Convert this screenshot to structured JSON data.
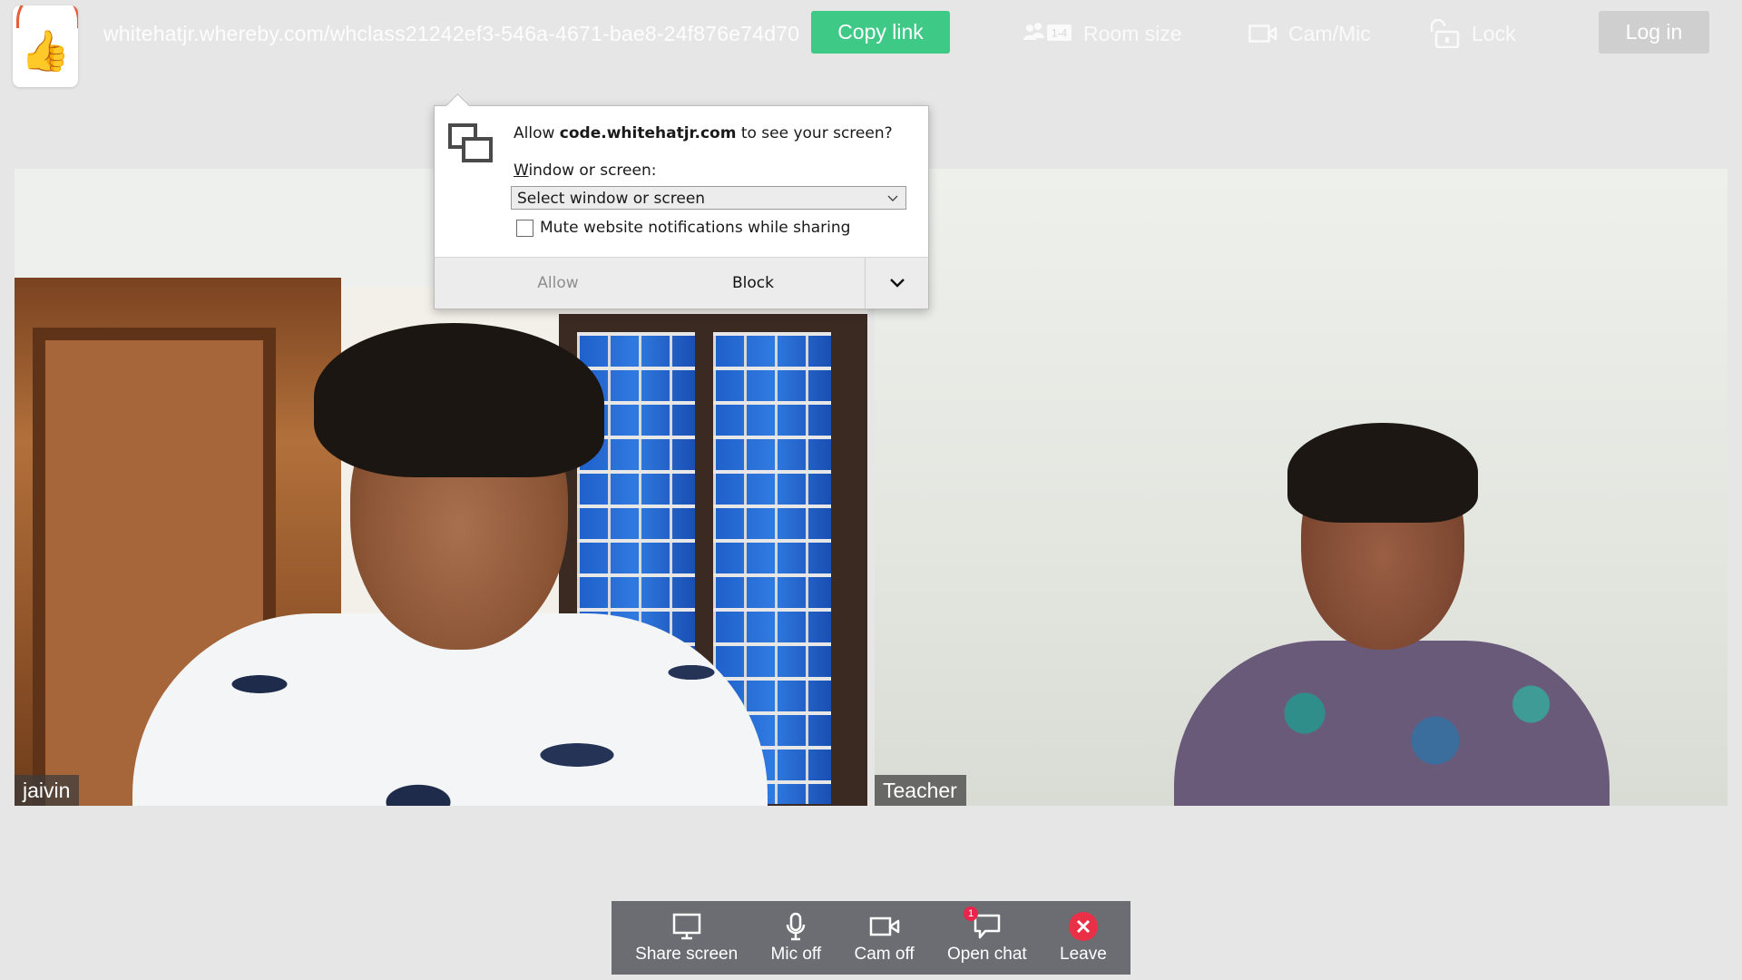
{
  "header": {
    "room_url": "whitehatjr.whereby.com/whclass21242ef3-546a-4671-bae8-24f876e74d70",
    "copy_link_label": "Copy link",
    "room_size_badge": "1-4",
    "room_size_label": "Room size",
    "cam_mic_label": "Cam/Mic",
    "lock_label": "Lock",
    "login_label": "Log in",
    "logo_icon": "thumbs-up-icon"
  },
  "permission_popup": {
    "prefix": "Allow ",
    "domain": "code.whitehatjr.com",
    "suffix": " to see your screen?",
    "window_label": "Window or screen:",
    "select_value": "Select window or screen",
    "mute_label": "Mute website notifications while sharing",
    "mute_checked": false,
    "allow_label": "Allow",
    "block_label": "Block"
  },
  "participants": [
    {
      "name": "jaivin"
    },
    {
      "name": "Teacher"
    }
  ],
  "toolbar": {
    "share_label": "Share screen",
    "mic_label": "Mic off",
    "cam_label": "Cam off",
    "chat_label": "Open chat",
    "chat_badge": "1",
    "leave_label": "Leave"
  },
  "colors": {
    "accent_green": "#3fc986",
    "leave_red": "#ea3047",
    "toolbar_bg": "#6c6d72",
    "page_bg": "#e6e6e6"
  }
}
